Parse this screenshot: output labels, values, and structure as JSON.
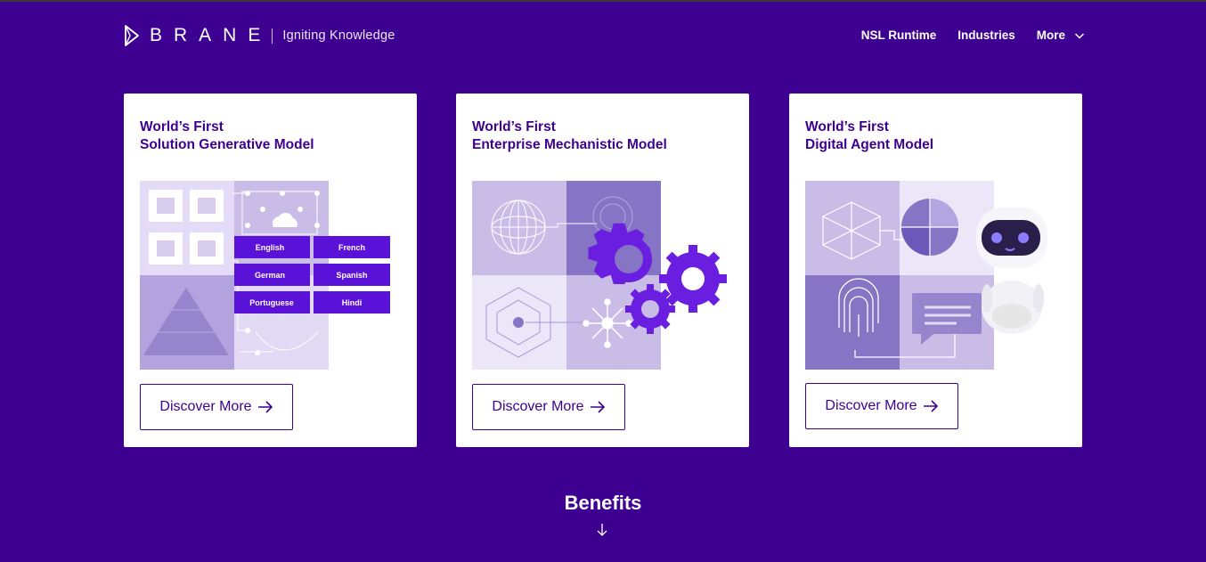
{
  "header": {
    "logo_text": "BRANE",
    "tagline": "Igniting Knowledge",
    "nav": [
      {
        "label": "NSL Runtime"
      },
      {
        "label": "Industries"
      },
      {
        "label": "More"
      }
    ]
  },
  "cards": [
    {
      "title_line1": "World’s First",
      "title_line2": "Solution Generative Model",
      "languages": [
        "English",
        "French",
        "German",
        "Spanish",
        "Portuguese",
        "Hindi"
      ],
      "button_label": "Discover More"
    },
    {
      "title_line1": "World’s First",
      "title_line2": "Enterprise Mechanistic Model",
      "button_label": "Discover More"
    },
    {
      "title_line1": "World’s First",
      "title_line2": "Digital Agent Model",
      "button_label": "Discover More"
    }
  ],
  "benefits": {
    "label": "Benefits"
  },
  "colors": {
    "background": "#3d0090",
    "card": "#ffffff",
    "accent": "#5b12d8",
    "light_lavender": "#c9bde8",
    "mid_lavender": "#8a78c8"
  }
}
